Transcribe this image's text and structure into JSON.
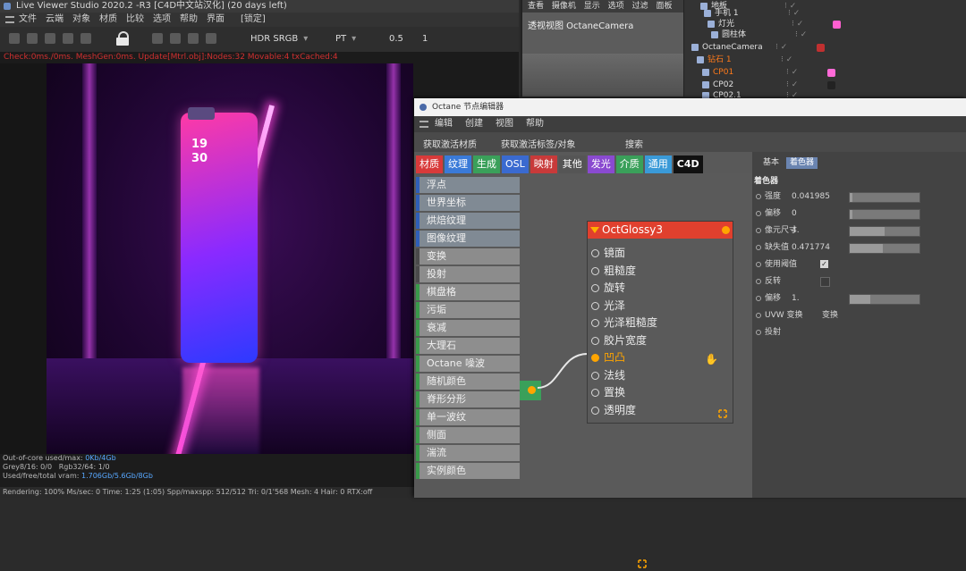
{
  "live_viewer": {
    "title": "Live Viewer Studio 2020.2 -R3 [C4D中文站汉化] (20 days left)",
    "menu": [
      "文件",
      "云端",
      "对象",
      "材质",
      "比较",
      "选项",
      "帮助",
      "界面",
      "[锁定]"
    ],
    "toolbar": {
      "color_mode": "HDR SRGB",
      "kernel": "PT",
      "value_a": "0.5",
      "value_b": "1"
    },
    "status_line": "Check:0ms./0ms. MeshGen:0ms. Update[Mtrl.obj]:Nodes:32 Movable:4 txCached:4",
    "phone_clock": [
      "19",
      "30"
    ],
    "footer": {
      "rows": [
        {
          "label": "Out-of-core used/max:",
          "value": "0Kb/4Gb"
        },
        {
          "label": "Grey8/16: 0/0",
          "value": "Rgb32/64: 1/0"
        },
        {
          "label": "Used/free/total vram:",
          "value": "1.706Gb/5.6Gb/8Gb"
        }
      ],
      "bar": "Rendering: 100%  Ms/sec: 0  Time: 1:25 (1:05)  Spp/maxspp: 512/512  Tri: 0/1'568  Mesh: 4  Hair: 0  RTX:off"
    }
  },
  "viewport": {
    "tabs": [
      "查看",
      "摄像机",
      "显示",
      "选项",
      "过滤",
      "面板"
    ],
    "camera_label": "透视视图 OctaneCamera"
  },
  "object_manager": {
    "rows": [
      {
        "label": "地板",
        "flags": "⁝ ✓",
        "highlight": false
      },
      {
        "label": "手机 1",
        "flags": "⁝ ✓",
        "highlight": false
      },
      {
        "label": "灯光",
        "flags": "⁝ ✓",
        "highlight": false
      },
      {
        "label": "圆柱体",
        "flags": "⁝ ✓",
        "highlight": false
      },
      {
        "label": "OctaneCamera",
        "flags": "⁝ ✓",
        "highlight": false
      },
      {
        "label": "钻石 1",
        "flags": "⁝ ✓",
        "highlight": true
      },
      {
        "label": "CP01",
        "flags": "⁝ ✓",
        "highlight": true
      },
      {
        "label": "CP02",
        "flags": "⁝ ✓",
        "highlight": false
      },
      {
        "label": "CP02.1",
        "flags": "⁝ ✓",
        "highlight": false
      }
    ]
  },
  "node_editor": {
    "title": "Octane 节点编辑器",
    "menu": [
      "编辑",
      "创建",
      "视图",
      "帮助"
    ],
    "tools": [
      "获取激活材质",
      "获取激活标签/对象",
      "搜索"
    ],
    "categories": [
      {
        "label": "材质",
        "color": "#d83a3a"
      },
      {
        "label": "纹理",
        "color": "#3a7ad8"
      },
      {
        "label": "生成",
        "color": "#3aa05a"
      },
      {
        "label": "OSL",
        "color": "#3a6ad0"
      },
      {
        "label": "映射",
        "color": "#c83a3a"
      },
      {
        "label": "其他",
        "color": "#555555"
      },
      {
        "label": "发光",
        "color": "#8a4ad0"
      },
      {
        "label": "介质",
        "color": "#3aa05a"
      },
      {
        "label": "通用",
        "color": "#3a9ad8"
      },
      {
        "label": "C4D",
        "color": "#111111"
      }
    ],
    "left_list": [
      {
        "label": "浮点",
        "group": "grp-a"
      },
      {
        "label": "世界坐标",
        "group": "grp-a"
      },
      {
        "label": "烘焙纹理",
        "group": "grp-a"
      },
      {
        "label": "图像纹理",
        "group": "grp-a"
      },
      {
        "label": "变换",
        "group": "grp-b"
      },
      {
        "label": "投射",
        "group": "grp-b"
      },
      {
        "label": "棋盘格",
        "group": "grp-c"
      },
      {
        "label": "污垢",
        "group": "grp-c"
      },
      {
        "label": "衰减",
        "group": "grp-c"
      },
      {
        "label": "大理石",
        "group": "grp-c"
      },
      {
        "label": "Octane 噪波",
        "group": "grp-c"
      },
      {
        "label": "随机颜色",
        "group": "grp-c"
      },
      {
        "label": "脊形分形",
        "group": "grp-c"
      },
      {
        "label": "单一波纹",
        "group": "grp-c"
      },
      {
        "label": "侧面",
        "group": "grp-c"
      },
      {
        "label": "湍流",
        "group": "grp-c"
      },
      {
        "label": "实例颜色",
        "group": "grp-c"
      }
    ],
    "node": {
      "title": "OctGlossy3",
      "ports": [
        {
          "label": "镜面",
          "active": false
        },
        {
          "label": "粗糙度",
          "active": false
        },
        {
          "label": "旋转",
          "active": false
        },
        {
          "label": "光泽",
          "active": false
        },
        {
          "label": "光泽粗糙度",
          "active": false
        },
        {
          "label": "胶片宽度",
          "active": false
        },
        {
          "label": "凹凸",
          "active": true
        },
        {
          "label": "法线",
          "active": false
        },
        {
          "label": "置换",
          "active": false
        },
        {
          "label": "透明度",
          "active": false
        }
      ]
    },
    "attributes": {
      "tabs": [
        "基本",
        "着色器"
      ],
      "active_tab": "着色器",
      "section": "着色器",
      "rows": [
        {
          "label": "强度",
          "value": "0.041985",
          "kind": "slider",
          "fill": 0.04
        },
        {
          "label": "偏移",
          "value": "0",
          "kind": "slider",
          "fill": 0.0
        },
        {
          "label": "像元尺寸",
          "value": "4.",
          "kind": "slider",
          "fill": 0.5
        },
        {
          "label": "缺失值",
          "value": "0.471774",
          "kind": "slider",
          "fill": 0.47
        },
        {
          "label": "使用阈值",
          "value": "✓",
          "kind": "check"
        },
        {
          "label": "反转",
          "value": "",
          "kind": "checkoff"
        },
        {
          "label": "偏移",
          "value": "1.",
          "kind": "slider",
          "fill": 0.3
        },
        {
          "label": "UVW 变换",
          "value": "变换",
          "kind": "text"
        },
        {
          "label": "投射",
          "value": "",
          "kind": "text"
        }
      ]
    }
  }
}
